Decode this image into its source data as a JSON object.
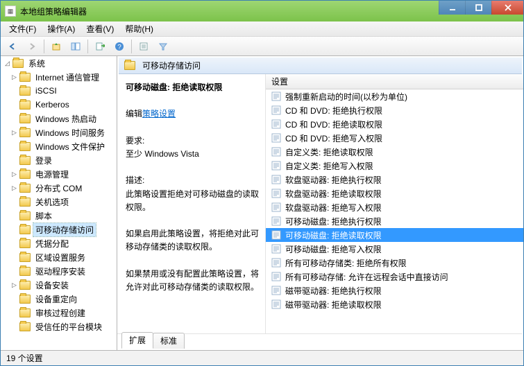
{
  "window": {
    "title": "本地组策略编辑器"
  },
  "menu": {
    "file": "文件(F)",
    "action": "操作(A)",
    "view": "查看(V)",
    "help": "帮助(H)"
  },
  "tree": {
    "root": "系统",
    "items": [
      "Internet 通信管理",
      "iSCSI",
      "Kerberos",
      "Windows 热启动",
      "Windows 时间服务",
      "Windows 文件保护",
      "登录",
      "电源管理",
      "分布式 COM",
      "关机选项",
      "脚本",
      "可移动存储访问",
      "凭据分配",
      "区域设置服务",
      "驱动程序安装",
      "设备安装",
      "设备重定向",
      "审核过程创建",
      "受信任的平台模块"
    ],
    "selected_index": 11,
    "expandable": [
      0,
      4,
      7,
      8,
      15
    ]
  },
  "detail": {
    "header_title": "可移动存储访问",
    "policy_name": "可移动磁盘: 拒绝读取权限",
    "edit_label_prefix": "编辑",
    "edit_link": "策略设置",
    "requirements_label": "要求:",
    "requirements_text": "至少 Windows Vista",
    "description_label": "描述:",
    "description_text1": "此策略设置拒绝对可移动磁盘的读取权限。",
    "description_text2": "如果启用此策略设置，将拒绝对此可移动存储类的读取权限。",
    "description_text3": "如果禁用或没有配置此策略设置，将允许对此可移动存储类的读取权限。"
  },
  "list": {
    "column": "设置",
    "rows": [
      "强制重新启动的时间(以秒为单位)",
      "CD 和 DVD: 拒绝执行权限",
      "CD 和 DVD: 拒绝读取权限",
      "CD 和 DVD: 拒绝写入权限",
      "自定义类: 拒绝读取权限",
      "自定义类: 拒绝写入权限",
      "软盘驱动器: 拒绝执行权限",
      "软盘驱动器: 拒绝读取权限",
      "软盘驱动器: 拒绝写入权限",
      "可移动磁盘: 拒绝执行权限",
      "可移动磁盘: 拒绝读取权限",
      "可移动磁盘: 拒绝写入权限",
      "所有可移动存储类: 拒绝所有权限",
      "所有可移动存储: 允许在远程会话中直接访问",
      "磁带驱动器: 拒绝执行权限",
      "磁带驱动器: 拒绝读取权限"
    ],
    "selected_index": 10
  },
  "tabs": {
    "extended": "扩展",
    "standard": "标准",
    "active": 0
  },
  "status": {
    "text": "19 个设置"
  }
}
